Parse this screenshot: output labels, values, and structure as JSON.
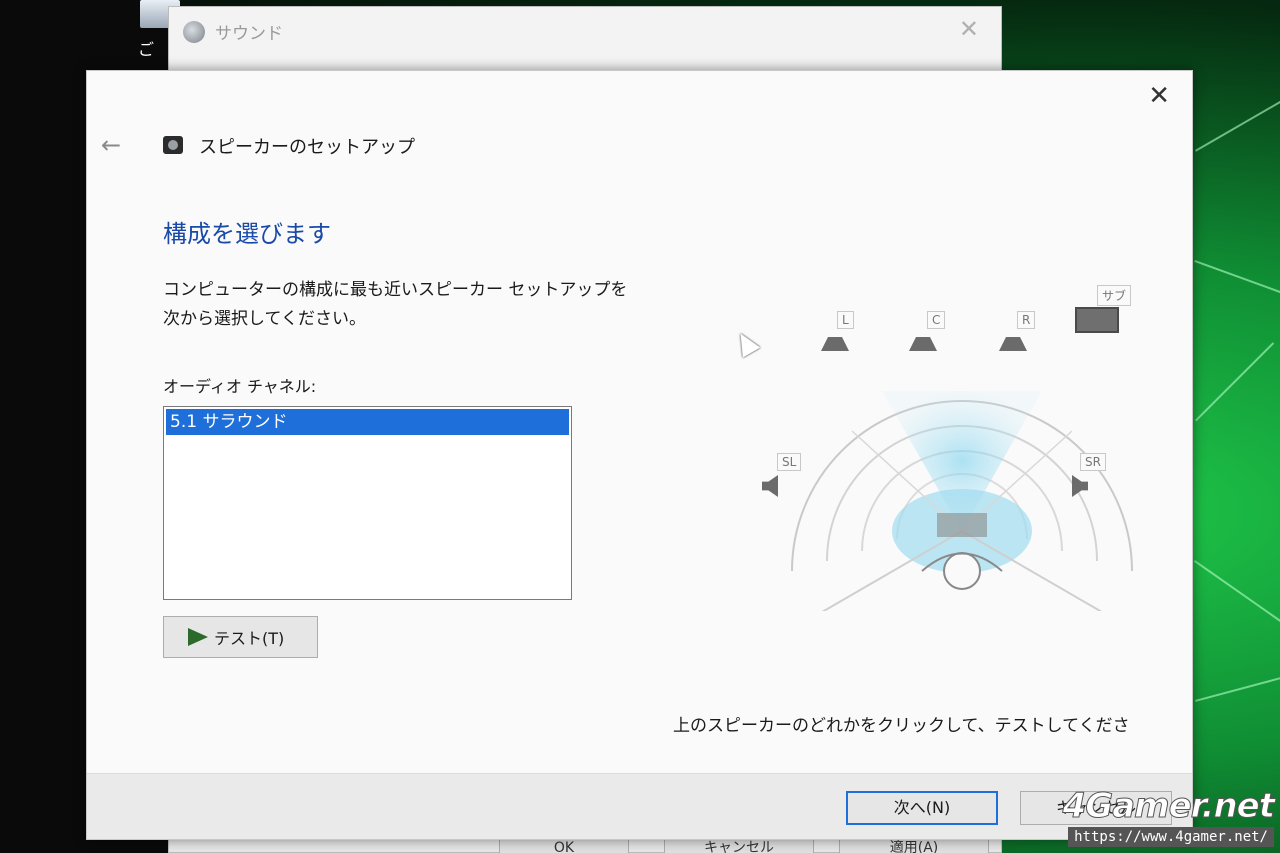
{
  "desktop": {
    "partial_text": "ご"
  },
  "sound_window": {
    "title": "サウンド",
    "close_glyph": "✕",
    "ok_label": "OK",
    "cancel_label": "キャンセル",
    "apply_label": "適用(A)"
  },
  "dialog": {
    "close_glyph": "✕",
    "back_glyph": "←",
    "header_title": "スピーカーのセットアップ",
    "section_heading": "構成を選びます",
    "description_line1": "コンピューターの構成に最も近いスピーカー セットアップを",
    "description_line2": "次から選択してください。",
    "channel_label": "オーディオ チャネル:",
    "channel_list": [
      {
        "label": "5.1 サラウンド",
        "selected": true
      }
    ],
    "test_button": "テスト(T)",
    "hint": "上のスピーカーのどれかをクリックして、テストしてくださ",
    "next_button": "次へ(N)",
    "cancel_button": "キャンセル"
  },
  "speakers": {
    "front_left": "L",
    "center": "C",
    "front_right": "R",
    "subwoofer": "サブ",
    "surround_left": "SL",
    "surround_right": "SR"
  },
  "watermark": {
    "logo": "4Gamer.net",
    "url": "https://www.4gamer.net/"
  },
  "colors": {
    "accent": "#1e6fd9",
    "heading": "#1a4aa8",
    "play_icon": "#2c6a2c"
  }
}
